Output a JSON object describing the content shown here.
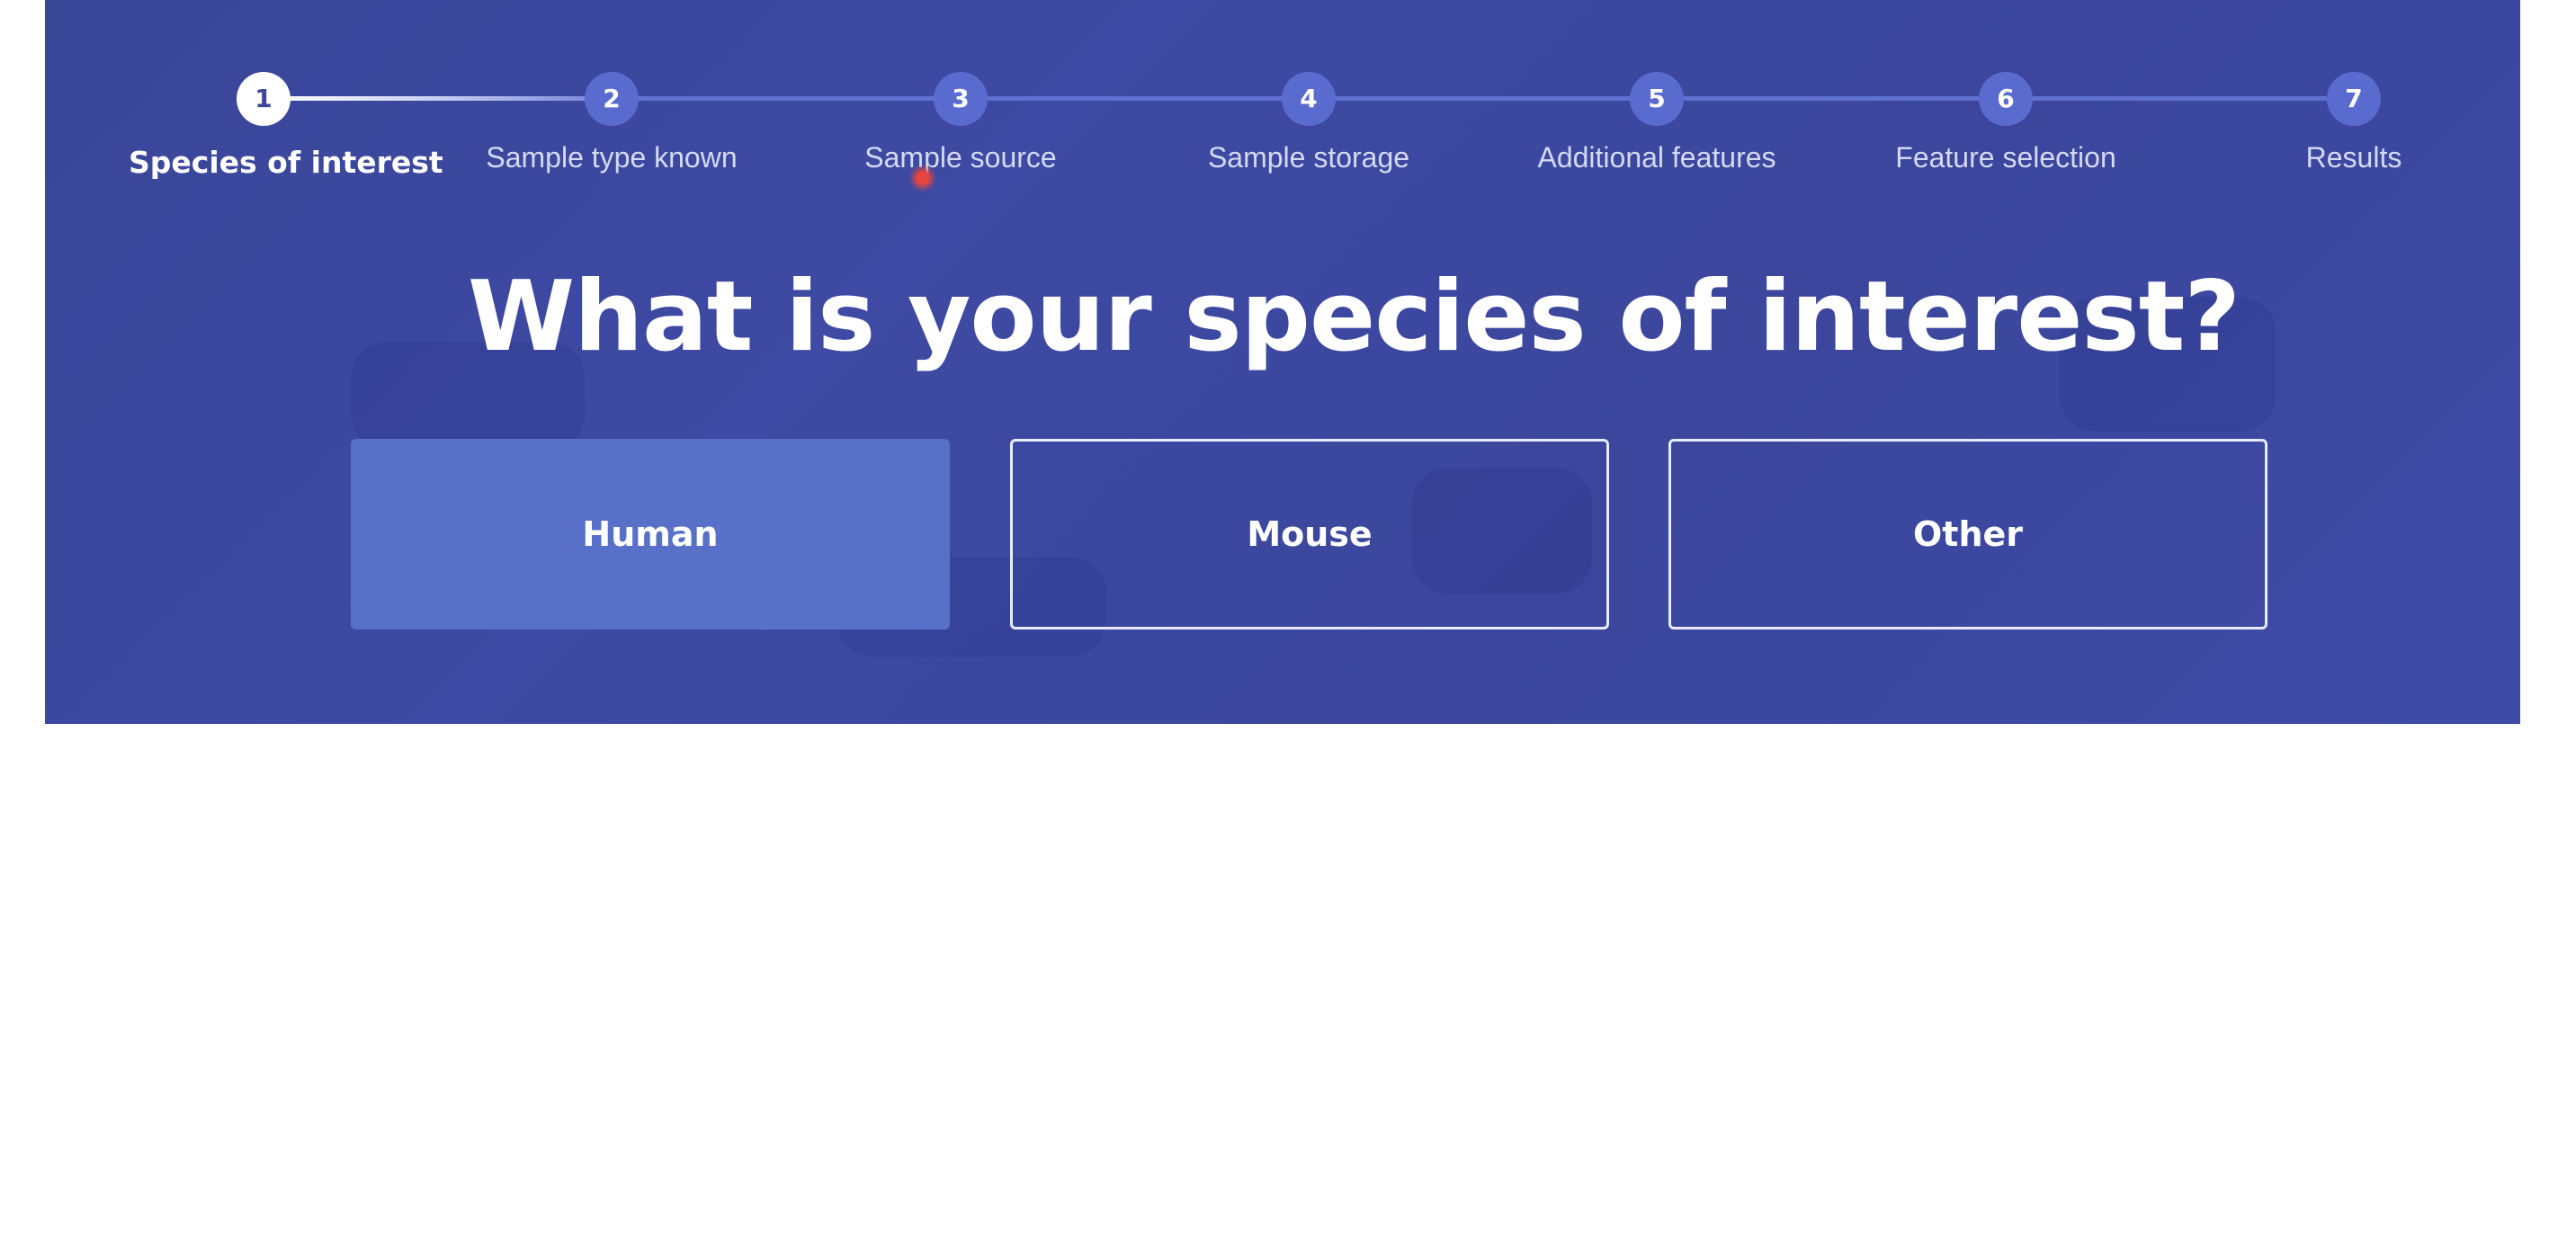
{
  "colors": {
    "hero_background": "#3d48a0",
    "step_active_fill": "#ffffff",
    "step_inactive_fill": "#5a6bd0",
    "selected_option": "#5870c8",
    "text": "#ffffff"
  },
  "stepper": {
    "current_step": 1,
    "steps": [
      {
        "number": "1",
        "label": "Species of interest"
      },
      {
        "number": "2",
        "label": "Sample type known"
      },
      {
        "number": "3",
        "label": "Sample source"
      },
      {
        "number": "4",
        "label": "Sample storage"
      },
      {
        "number": "5",
        "label": "Additional features"
      },
      {
        "number": "6",
        "label": "Feature selection"
      },
      {
        "number": "7",
        "label": "Results"
      }
    ]
  },
  "question": "What is your species of interest?",
  "options": [
    {
      "label": "Human",
      "selected": true
    },
    {
      "label": "Mouse",
      "selected": false
    },
    {
      "label": "Other",
      "selected": false
    }
  ]
}
